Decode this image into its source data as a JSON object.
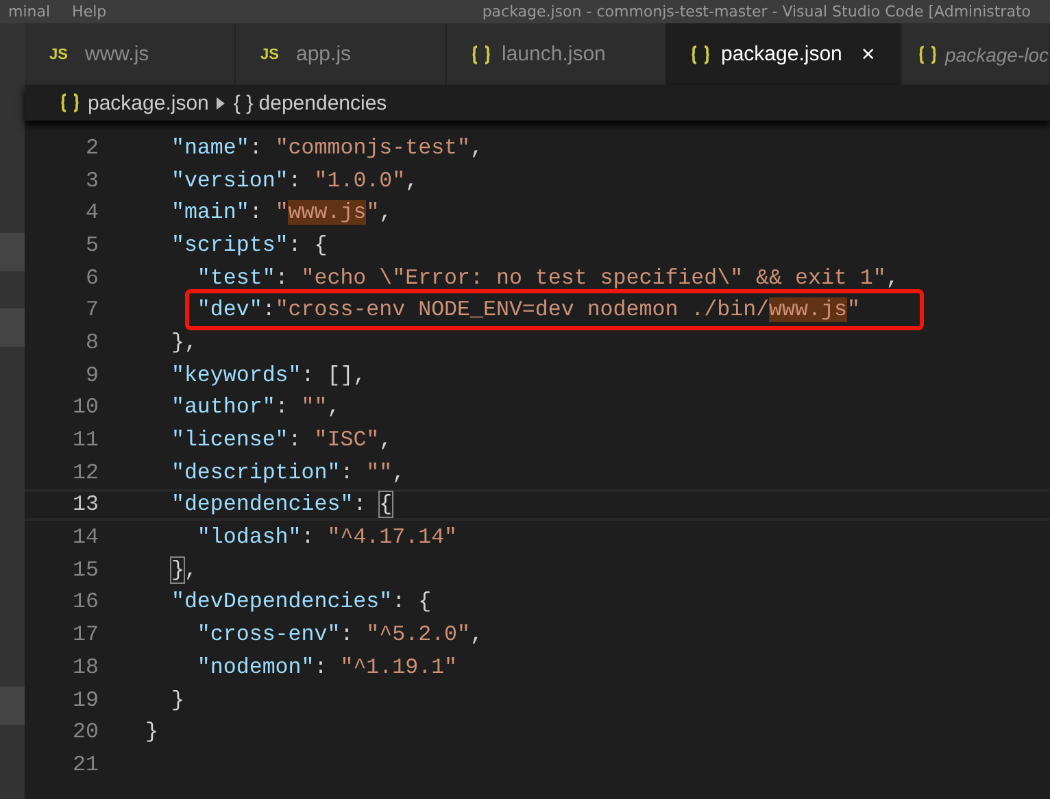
{
  "title_bar": {
    "menu": [
      "minal",
      "Help"
    ],
    "title": "package.json - commonjs-test-master - Visual Studio Code [Administrato"
  },
  "tabs": [
    {
      "label": "www.js",
      "badge": "JS",
      "selected": false,
      "preview": false
    },
    {
      "label": "app.js",
      "badge": "JS",
      "selected": false,
      "preview": false
    },
    {
      "label": "launch.json",
      "selected": false,
      "preview": false
    },
    {
      "label": "package.json",
      "selected": true,
      "preview": false,
      "close": "×"
    },
    {
      "label": "package-loc",
      "selected": false,
      "preview": true
    }
  ],
  "breadcrumb": [
    {
      "label": "package.json",
      "kind": "file"
    },
    {
      "label": "{ } dependencies",
      "kind": "symbol"
    }
  ],
  "lines": [
    {
      "number": "2",
      "current": false,
      "boxed": false,
      "tokens": [
        {
          "kind": "key",
          "text": "  \"name\""
        },
        {
          "kind": "punct",
          "text": ": "
        },
        {
          "kind": "str",
          "text": "\"commonjs-test\""
        },
        {
          "kind": "punct",
          "text": ","
        }
      ]
    },
    {
      "number": "3",
      "current": false,
      "boxed": false,
      "tokens": [
        {
          "kind": "key",
          "text": "  \"version\""
        },
        {
          "kind": "punct",
          "text": ": "
        },
        {
          "kind": "str",
          "text": "\"1.0.0\""
        },
        {
          "kind": "punct",
          "text": ","
        }
      ]
    },
    {
      "number": "4",
      "current": false,
      "boxed": false,
      "tokens": [
        {
          "kind": "key",
          "text": "  \"main\""
        },
        {
          "kind": "punct",
          "text": ": "
        },
        {
          "kind": "str",
          "text": "\""
        },
        {
          "kind": "match",
          "text": "www.js"
        },
        {
          "kind": "str",
          "text": "\""
        },
        {
          "kind": "punct",
          "text": ","
        }
      ]
    },
    {
      "number": "5",
      "current": false,
      "boxed": false,
      "tokens": [
        {
          "kind": "key",
          "text": "  \"scripts\""
        },
        {
          "kind": "punct",
          "text": ": {"
        }
      ]
    },
    {
      "number": "6",
      "current": false,
      "boxed": false,
      "tokens": [
        {
          "kind": "key",
          "text": "    \"test\""
        },
        {
          "kind": "punct",
          "text": ": "
        },
        {
          "kind": "str",
          "text": "\"echo \\\"Error: no test specified\\\" && exit 1\""
        },
        {
          "kind": "punct",
          "text": ","
        }
      ]
    },
    {
      "number": "7",
      "current": false,
      "boxed": true,
      "tokens": [
        {
          "kind": "key",
          "text": "\"dev\""
        },
        {
          "kind": "punct",
          "text": ":"
        },
        {
          "kind": "str",
          "text": "\"cross-env NODE_ENV=dev nodemon ./bin/"
        },
        {
          "kind": "match",
          "text": "www.js"
        },
        {
          "kind": "str",
          "text": "\""
        }
      ]
    },
    {
      "number": "8",
      "current": false,
      "boxed": false,
      "tokens": [
        {
          "kind": "punct",
          "text": "  },"
        }
      ]
    },
    {
      "number": "9",
      "current": false,
      "boxed": false,
      "tokens": [
        {
          "kind": "key",
          "text": "  \"keywords\""
        },
        {
          "kind": "punct",
          "text": ": [],"
        }
      ]
    },
    {
      "number": "10",
      "current": false,
      "boxed": false,
      "tokens": [
        {
          "kind": "key",
          "text": "  \"author\""
        },
        {
          "kind": "punct",
          "text": ": "
        },
        {
          "kind": "str",
          "text": "\"\""
        },
        {
          "kind": "punct",
          "text": ","
        }
      ]
    },
    {
      "number": "11",
      "current": false,
      "boxed": false,
      "tokens": [
        {
          "kind": "key",
          "text": "  \"license\""
        },
        {
          "kind": "punct",
          "text": ": "
        },
        {
          "kind": "str",
          "text": "\"ISC\""
        },
        {
          "kind": "punct",
          "text": ","
        }
      ]
    },
    {
      "number": "12",
      "current": false,
      "boxed": false,
      "tokens": [
        {
          "kind": "key",
          "text": "  \"description\""
        },
        {
          "kind": "punct",
          "text": ": "
        },
        {
          "kind": "str",
          "text": "\"\""
        },
        {
          "kind": "punct",
          "text": ","
        }
      ]
    },
    {
      "number": "13",
      "current": true,
      "boxed": false,
      "tokens": [
        {
          "kind": "key",
          "text": "  \"dependencies\""
        },
        {
          "kind": "punct",
          "text": ": "
        },
        {
          "kind": "bracket",
          "text": "{"
        }
      ]
    },
    {
      "number": "14",
      "current": false,
      "boxed": false,
      "tokens": [
        {
          "kind": "key",
          "text": "    \"lodash\""
        },
        {
          "kind": "punct",
          "text": ": "
        },
        {
          "kind": "str",
          "text": "\"^4.17.14\""
        }
      ]
    },
    {
      "number": "15",
      "current": false,
      "boxed": false,
      "tokens": [
        {
          "kind": "bracket",
          "text": "  }"
        },
        {
          "kind": "punct",
          "text": ","
        }
      ]
    },
    {
      "number": "16",
      "current": false,
      "boxed": false,
      "tokens": [
        {
          "kind": "key",
          "text": "  \"devDependencies\""
        },
        {
          "kind": "punct",
          "text": ": {"
        }
      ]
    },
    {
      "number": "17",
      "current": false,
      "boxed": false,
      "tokens": [
        {
          "kind": "key",
          "text": "    \"cross-env\""
        },
        {
          "kind": "punct",
          "text": ": "
        },
        {
          "kind": "str",
          "text": "\"^5.2.0\""
        },
        {
          "kind": "punct",
          "text": ","
        }
      ]
    },
    {
      "number": "18",
      "current": false,
      "boxed": false,
      "tokens": [
        {
          "kind": "key",
          "text": "    \"nodemon\""
        },
        {
          "kind": "punct",
          "text": ": "
        },
        {
          "kind": "str",
          "text": "\"^1.19.1\""
        }
      ]
    },
    {
      "number": "19",
      "current": false,
      "boxed": false,
      "tokens": [
        {
          "kind": "punct",
          "text": "  }"
        }
      ]
    },
    {
      "number": "20",
      "current": false,
      "boxed": false,
      "tokens": [
        {
          "kind": "punct",
          "text": "}"
        }
      ]
    },
    {
      "number": "21",
      "current": false
    }
  ]
}
